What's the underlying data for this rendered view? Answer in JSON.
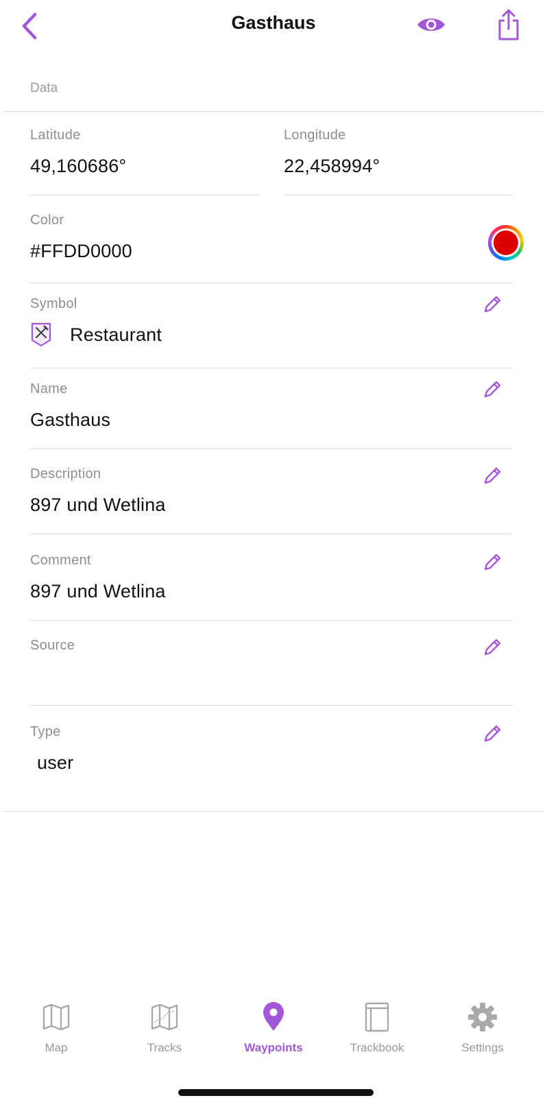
{
  "nav": {
    "title": "Gasthaus",
    "back_icon": "chevron-left-icon",
    "visibility_icon": "eye-icon",
    "share_icon": "share-icon"
  },
  "section": {
    "title": "Data"
  },
  "fields": {
    "latitude": {
      "label": "Latitude",
      "value": "49,160686°"
    },
    "longitude": {
      "label": "Longitude",
      "value": "22,458994°"
    },
    "color": {
      "label": "Color",
      "value": "#FFDD0000",
      "swatch": "#dd0000"
    },
    "symbol": {
      "label": "Symbol",
      "value": "Restaurant",
      "icon": "restaurant-icon"
    },
    "name": {
      "label": "Name",
      "value": "Gasthaus"
    },
    "description": {
      "label": "Description",
      "value": "897 und Wetlina"
    },
    "comment": {
      "label": "Comment",
      "value": "897 und Wetlina"
    },
    "source": {
      "label": "Source",
      "value": ""
    },
    "type": {
      "label": "Type",
      "value": "user"
    }
  },
  "tabs": [
    {
      "label": "Map",
      "icon": "map-icon",
      "active": false
    },
    {
      "label": "Tracks",
      "icon": "tracks-icon",
      "active": false
    },
    {
      "label": "Waypoints",
      "icon": "waypoint-pin-icon",
      "active": true
    },
    {
      "label": "Trackbook",
      "icon": "trackbook-icon",
      "active": false
    },
    {
      "label": "Settings",
      "icon": "gear-icon",
      "active": false
    }
  ],
  "colors": {
    "accent": "#a257d8",
    "label": "#8e8e8e",
    "divider": "#dcdcdc",
    "inactive_tab": "#9a9a9a"
  }
}
